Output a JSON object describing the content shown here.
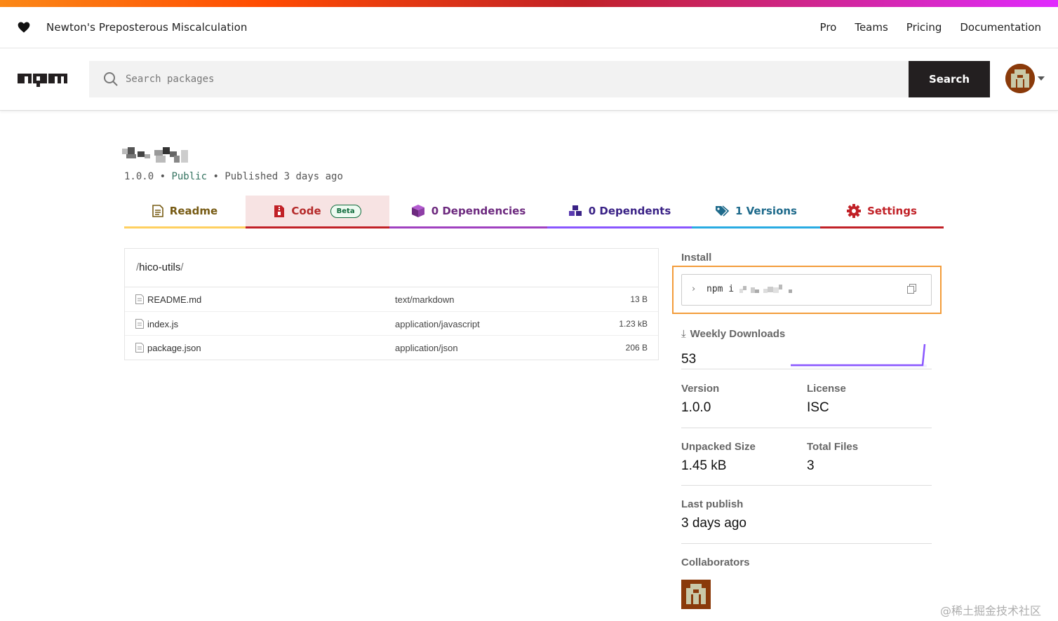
{
  "brand": {
    "tagline": "Newton's Preposterous Miscalculation",
    "nav": [
      "Pro",
      "Teams",
      "Pricing",
      "Documentation"
    ]
  },
  "search": {
    "placeholder": "Search packages",
    "button_label": "Search"
  },
  "package": {
    "version": "1.0.0",
    "visibility": "Public",
    "published": "Published 3 days ago"
  },
  "tabs": {
    "readme": "Readme",
    "code": "Code",
    "code_badge": "Beta",
    "dependencies": "0 Dependencies",
    "dependents": "0 Dependents",
    "versions": "1 Versions",
    "settings": "Settings"
  },
  "files": {
    "path": "hico-utils",
    "rows": [
      {
        "name": "README.md",
        "type": "text/markdown",
        "size": "13 B"
      },
      {
        "name": "index.js",
        "type": "application/javascript",
        "size": "1.23 kB"
      },
      {
        "name": "package.json",
        "type": "application/json",
        "size": "206 B"
      }
    ]
  },
  "sidebar": {
    "install_label": "Install",
    "install_command": "npm i",
    "weekly_downloads_label": "Weekly Downloads",
    "weekly_downloads": "53",
    "version_label": "Version",
    "version": "1.0.0",
    "license_label": "License",
    "license": "ISC",
    "unpacked_size_label": "Unpacked Size",
    "unpacked_size": "1.45 kB",
    "total_files_label": "Total Files",
    "total_files": "3",
    "last_publish_label": "Last publish",
    "last_publish": "3 days ago",
    "collaborators_label": "Collaborators"
  },
  "watermark": "@稀土掘金技术社区",
  "colors": {
    "accent_red": "#c12127",
    "readme": "#ffd060",
    "dependencies": "#a041c0",
    "dependents": "#8956ff",
    "versions": "#29abe2",
    "highlight": "#f39c3a"
  }
}
